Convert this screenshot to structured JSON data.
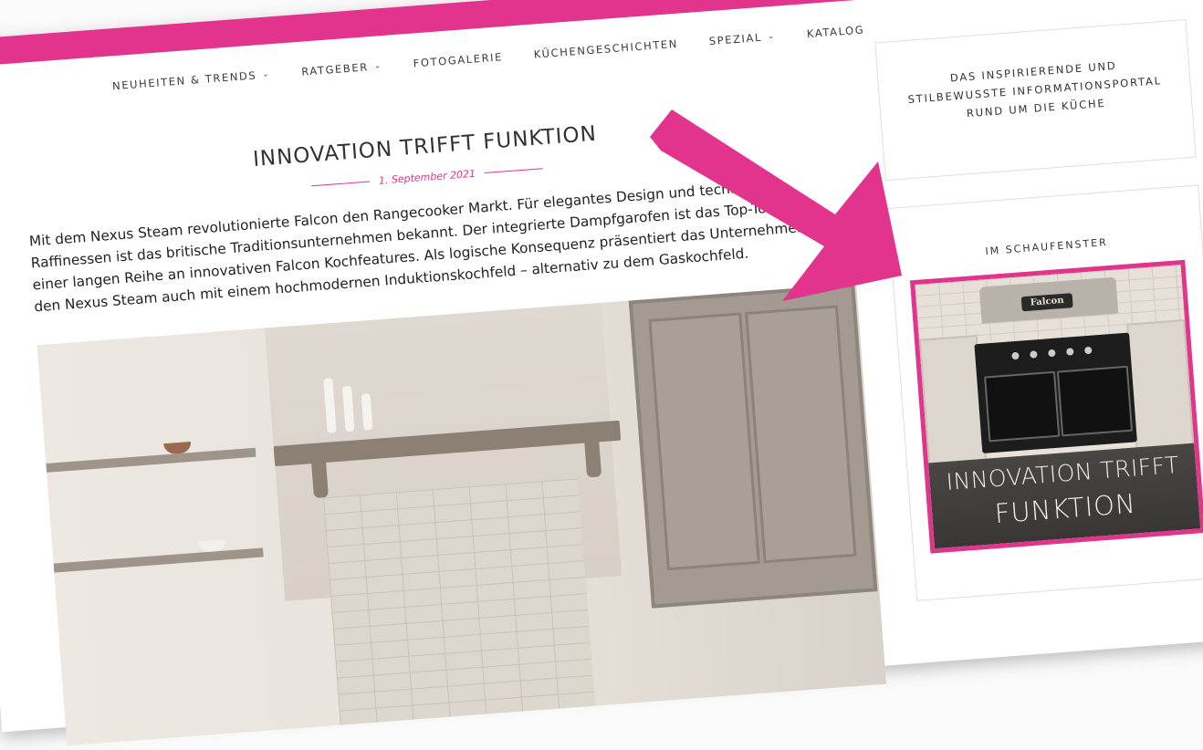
{
  "colors": {
    "accent": "#e2348c",
    "text": "#333333",
    "page": "#ffffff"
  },
  "nav": {
    "items": [
      {
        "label": "NEUHEITEN & TRENDS",
        "dropdown": true
      },
      {
        "label": "RATGEBER",
        "dropdown": true
      },
      {
        "label": "FOTOGALERIE",
        "dropdown": false
      },
      {
        "label": "KÜCHENGESCHICHTEN",
        "dropdown": false
      },
      {
        "label": "SPEZIAL",
        "dropdown": true
      },
      {
        "label": "KATALOG",
        "dropdown": false
      }
    ],
    "chevron": "⌄"
  },
  "article": {
    "title": "INNOVATION TRIFFT FUNKTION",
    "date": "1. September 2021",
    "body": "Mit dem Nexus Steam revolutionierte Falcon den Rangecooker Markt. Für elegantes Design und technische Raffinessen ist das britische Traditionsunternehmen bekannt. Der integrierte Dampfgarofen ist das Top-Tool in einer langen Reihe an innovativen Falcon Kochfeatures. Als logische Konsequenz präsentiert das Unternehmen den Nexus Steam auch mit einem hochmodernen Induktionskochfeld – alternativ zu dem Gaskochfeld."
  },
  "sidebar": {
    "tagline": "DAS INSPIRIERENDE UND STILBEWUSSTE INFORMATIONSPORTAL RUND UM DIE KÜCHE",
    "showcase": {
      "label": "IM SCHAUFENSTER",
      "brand": "Falcon",
      "line1": "INNOVATION TRIFFT",
      "line2": "FUNKTION"
    }
  },
  "icons": {
    "arrow": "arrow-icon",
    "chevron": "chevron-down-icon"
  }
}
